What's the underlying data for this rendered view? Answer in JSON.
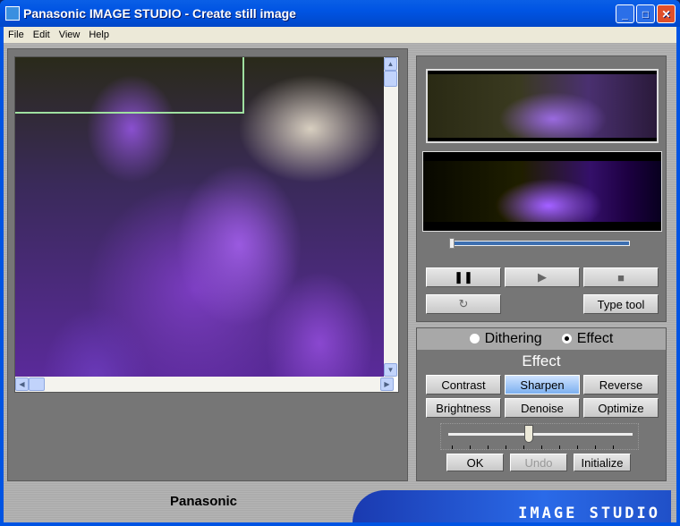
{
  "window": {
    "title": "Panasonic IMAGE STUDIO - Create still image",
    "minimize": "_",
    "maximize": "□",
    "close": "✕"
  },
  "menu": [
    "File",
    "Edit",
    "View",
    "Help"
  ],
  "playback": {
    "pause": "❚❚",
    "play": "▶",
    "stop": "■",
    "loop": "↻",
    "type_tool": "Type tool",
    "position": 0.0
  },
  "mode": {
    "options": [
      "Dithering",
      "Effect"
    ],
    "selected": "Effect"
  },
  "effect": {
    "title": "Effect",
    "buttons": [
      "Contrast",
      "Sharpen",
      "Reverse",
      "Brightness",
      "Denoise",
      "Optimize"
    ],
    "selected": "Sharpen",
    "level": 0.45,
    "ok": "OK",
    "undo": "Undo",
    "initialize": "Initialize"
  },
  "footer": {
    "brand": "Panasonic",
    "product": "IMAGE STUDIO"
  },
  "colors": {
    "titlebar": "#0054e3",
    "panel": "#767676",
    "selected_button": "#7db0f0"
  }
}
